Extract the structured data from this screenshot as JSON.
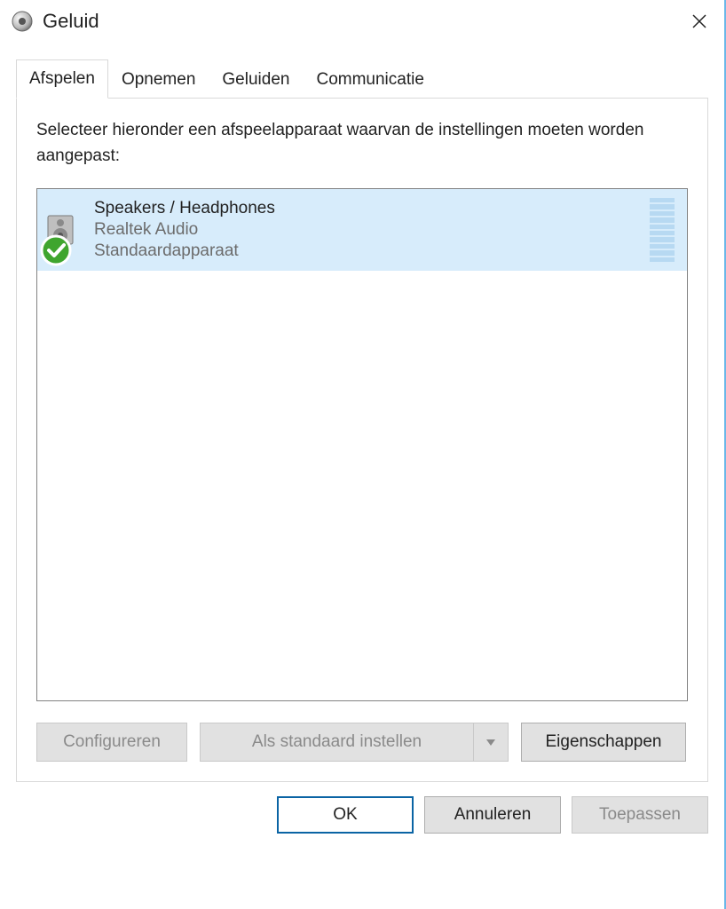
{
  "window": {
    "title": "Geluid"
  },
  "tabs": [
    {
      "label": "Afspelen",
      "active": true
    },
    {
      "label": "Opnemen",
      "active": false
    },
    {
      "label": "Geluiden",
      "active": false
    },
    {
      "label": "Communicatie",
      "active": false
    }
  ],
  "panel": {
    "instruction": "Selecteer hieronder een afspeelapparaat waarvan de instellingen moeten worden aangepast:",
    "devices": [
      {
        "name": "Speakers / Headphones",
        "vendor": "Realtek Audio",
        "status": "Standaardapparaat",
        "selected": true,
        "default": true
      }
    ],
    "buttons": {
      "configure": "Configureren",
      "set_default": "Als standaard instellen",
      "properties": "Eigenschappen"
    }
  },
  "dialog_buttons": {
    "ok": "OK",
    "cancel": "Annuleren",
    "apply": "Toepassen"
  }
}
